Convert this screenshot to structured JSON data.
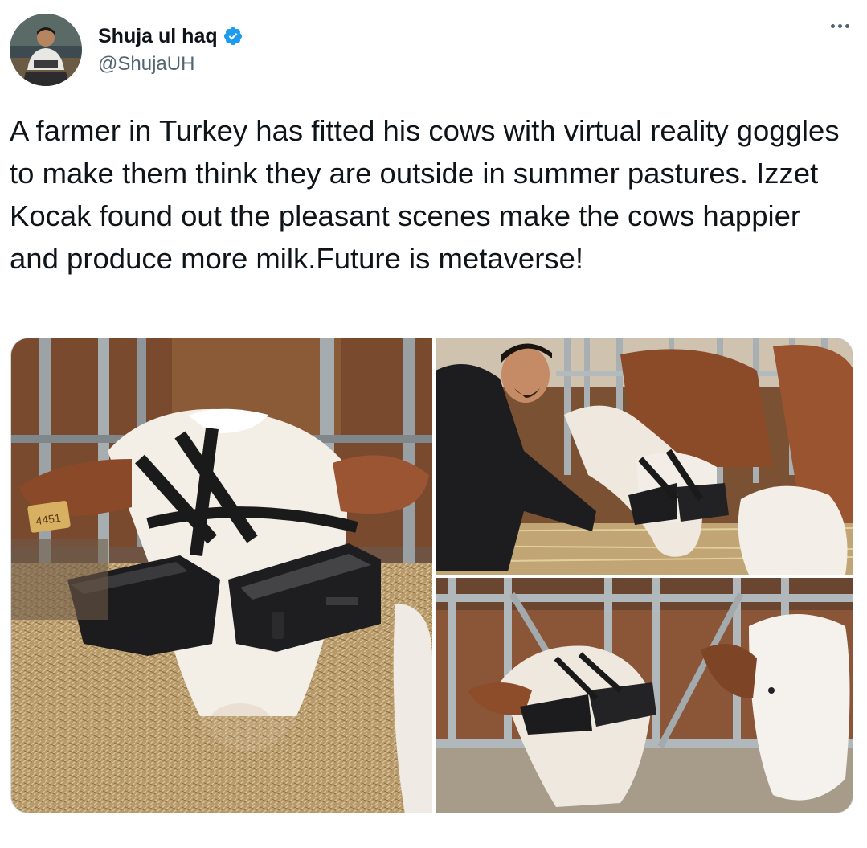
{
  "author": {
    "display_name": "Shuja ul haq",
    "handle": "@ShujaUH",
    "verified": true,
    "verified_icon": "verified-badge-icon",
    "verified_color": "#1d9bf0"
  },
  "more_icon": "more-horizontal-icon",
  "tweet": {
    "text": "A farmer in Turkey has fitted his cows with virtual reality goggles to make them think they are outside in summer pastures. Izzet Kocak found out the pleasant scenes make the cows happier and produce more milk.Future is metaverse!"
  },
  "media": {
    "photo_count": 3,
    "photos": [
      {
        "depicts": "cow wearing VR headset eating hay",
        "tag_text": "4451"
      },
      {
        "depicts": "farmer fitting VR headset on a cow"
      },
      {
        "depicts": "cows at feeding rail, one with VR headset"
      }
    ]
  },
  "colors": {
    "text_primary": "#0f1419",
    "text_secondary": "#536471",
    "border": "#cfd9de"
  }
}
